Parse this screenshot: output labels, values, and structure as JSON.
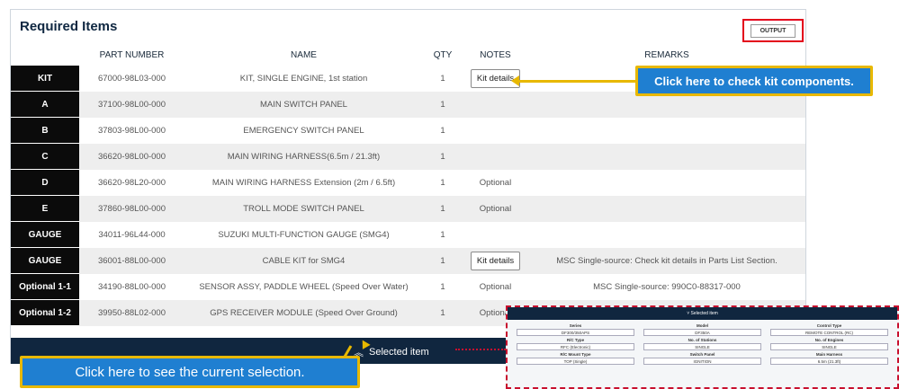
{
  "panel": {
    "title": "Required Items",
    "output_label": "OUTPUT"
  },
  "table": {
    "headers": [
      "PART NUMBER",
      "NAME",
      "QTY",
      "NOTES",
      "REMARKS"
    ],
    "rows": [
      {
        "key": "KIT",
        "part": "67000-98L03-000",
        "name": "KIT, SINGLE ENGINE, 1st station",
        "qty": "1",
        "notes": "Kit details",
        "notes_is_button": true,
        "remarks": ""
      },
      {
        "key": "A",
        "part": "37100-98L00-000",
        "name": "MAIN SWITCH PANEL",
        "qty": "1",
        "notes": "",
        "notes_is_button": false,
        "remarks": ""
      },
      {
        "key": "B",
        "part": "37803-98L00-000",
        "name": "EMERGENCY SWITCH PANEL",
        "qty": "1",
        "notes": "",
        "notes_is_button": false,
        "remarks": ""
      },
      {
        "key": "C",
        "part": "36620-98L00-000",
        "name": "MAIN WIRING HARNESS(6.5m / 21.3ft)",
        "qty": "1",
        "notes": "",
        "notes_is_button": false,
        "remarks": ""
      },
      {
        "key": "D",
        "part": "36620-98L20-000",
        "name": "MAIN WIRING HARNESS Extension (2m / 6.5ft)",
        "qty": "1",
        "notes": "Optional",
        "notes_is_button": false,
        "remarks": ""
      },
      {
        "key": "E",
        "part": "37860-98L00-000",
        "name": "TROLL MODE SWITCH PANEL",
        "qty": "1",
        "notes": "Optional",
        "notes_is_button": false,
        "remarks": ""
      },
      {
        "key": "GAUGE",
        "part": "34011-96L44-000",
        "name": "SUZUKI MULTI-FUNCTION GAUGE (SMG4)",
        "qty": "1",
        "notes": "",
        "notes_is_button": false,
        "remarks": ""
      },
      {
        "key": "GAUGE",
        "part": "36001-88L00-000",
        "name": "CABLE KIT for SMG4",
        "qty": "1",
        "notes": "Kit details",
        "notes_is_button": true,
        "remarks": "MSC Single-source: Check kit details in Parts List Section."
      },
      {
        "key": "Optional 1-1",
        "part": "34190-88L00-000",
        "name": "SENSOR ASSY, PADDLE WHEEL (Speed Over Water)",
        "qty": "1",
        "notes": "Optional",
        "notes_is_button": false,
        "remarks": "MSC Single-source: 990C0-88317-000"
      },
      {
        "key": "Optional 1-2",
        "part": "39950-88L02-000",
        "name": "GPS RECEIVER MODULE (Speed Over Ground)",
        "qty": "1",
        "notes": "Optional",
        "notes_is_button": false,
        "remarks": ""
      }
    ]
  },
  "selected_bar": {
    "label": "Selected item",
    "icon": "chevron-up-icon"
  },
  "callouts": {
    "kit": "Click here to check kit components.",
    "selection": "Click here to see the current selection."
  },
  "preview": {
    "header": "Selected item",
    "fields": [
      {
        "label": "Series",
        "value": "DF300/350APS"
      },
      {
        "label": "Model",
        "value": "DF350A"
      },
      {
        "label": "Control Type",
        "value": "REMOTE CONTROL (RC)"
      },
      {
        "label": "R/C Type",
        "value": "RFC (Electronic)"
      },
      {
        "label": "No. of Stations",
        "value": "SINGLE"
      },
      {
        "label": "No. of Engines",
        "value": "SINGLE"
      },
      {
        "label": "R/C Mount Type",
        "value": "TOP (Single)"
      },
      {
        "label": "Switch Panel",
        "value": "IGNITION"
      },
      {
        "label": "Main Harness",
        "value": "6.5m (21.3ft)"
      }
    ]
  },
  "colors": {
    "accent": "#1f7fd1",
    "callout_border": "#e8b800",
    "output_border": "#e3001b",
    "bar": "#10263f"
  }
}
